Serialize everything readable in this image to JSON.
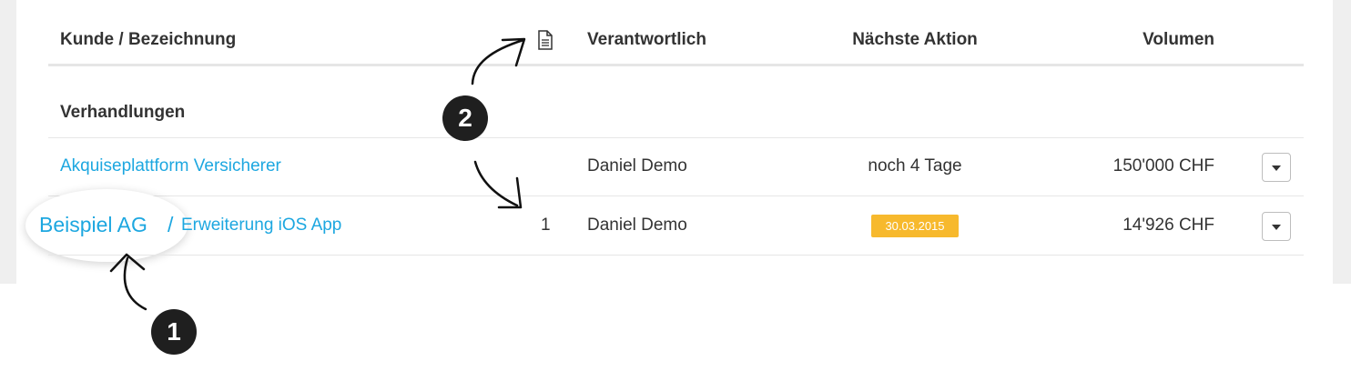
{
  "table": {
    "headers": {
      "customer": "Kunde / Bezeichnung",
      "doc_icon": "document-icon",
      "responsible": "Verantwortlich",
      "next_action": "Nächste Aktion",
      "volume": "Volumen"
    },
    "group_title": "Verhandlungen",
    "rows": [
      {
        "title": "Akquiseplattform Versicherer",
        "responsible": "Daniel Demo",
        "next_action": "noch 4 Tage",
        "volume": "150'000 CHF"
      },
      {
        "customer": "Beispiel AG",
        "separator": "/",
        "title": "Erweiterung iOS App",
        "doc_count": "1",
        "responsible": "Daniel Demo",
        "next_action": "30.03.2015",
        "volume": "14'926 CHF"
      }
    ]
  },
  "annotations": {
    "marker_1": "1",
    "marker_2": "2"
  },
  "colors": {
    "link": "#1da7e0",
    "badge": "#f7b92d",
    "panel_background": "#efefef"
  }
}
